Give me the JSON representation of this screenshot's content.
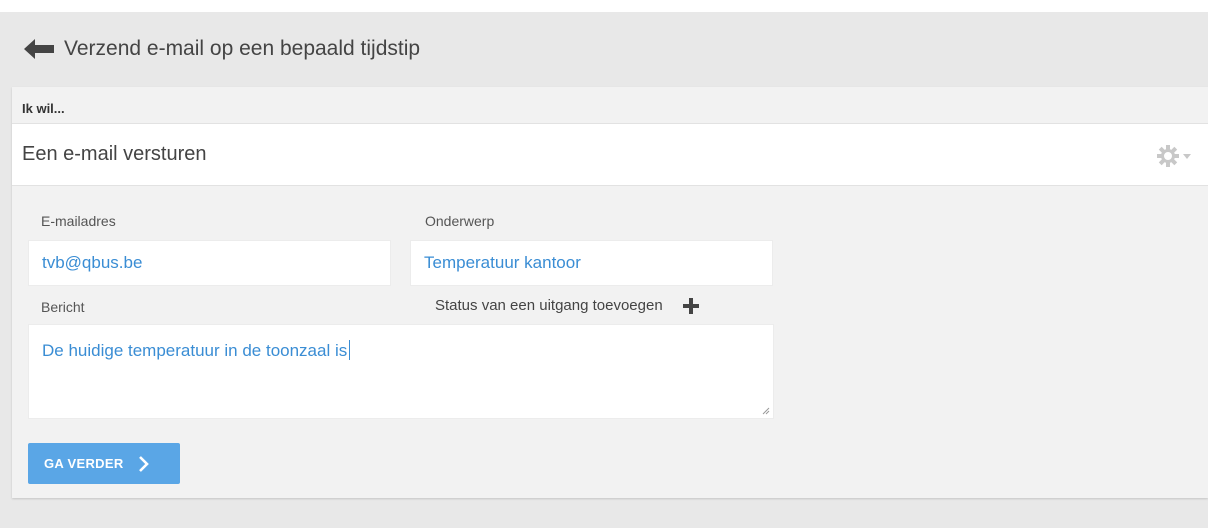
{
  "header": {
    "title": "Verzend e-mail op een bepaald tijdstip"
  },
  "section": {
    "label": "Ik wil..."
  },
  "action": {
    "label": "Een e-mail versturen"
  },
  "form": {
    "email_label": "E-mailadres",
    "email_value": "tvb@qbus.be",
    "subject_label": "Onderwerp",
    "subject_value": "Temperatuur kantoor",
    "message_label": "Bericht",
    "message_value": "De huidige temperatuur in de toonzaal is",
    "add_status_label": "Status van een uitgang toevoegen"
  },
  "buttons": {
    "continue_label": "GA VERDER"
  },
  "icons": {
    "back": "arrow-left-icon",
    "settings": "gear-icon",
    "dropdown": "caret-down-icon",
    "add": "plus-icon",
    "continue": "chevron-right-icon"
  },
  "colors": {
    "accent": "#3a8dd4",
    "button": "#5aa6e6",
    "background": "#e8e8e8"
  }
}
